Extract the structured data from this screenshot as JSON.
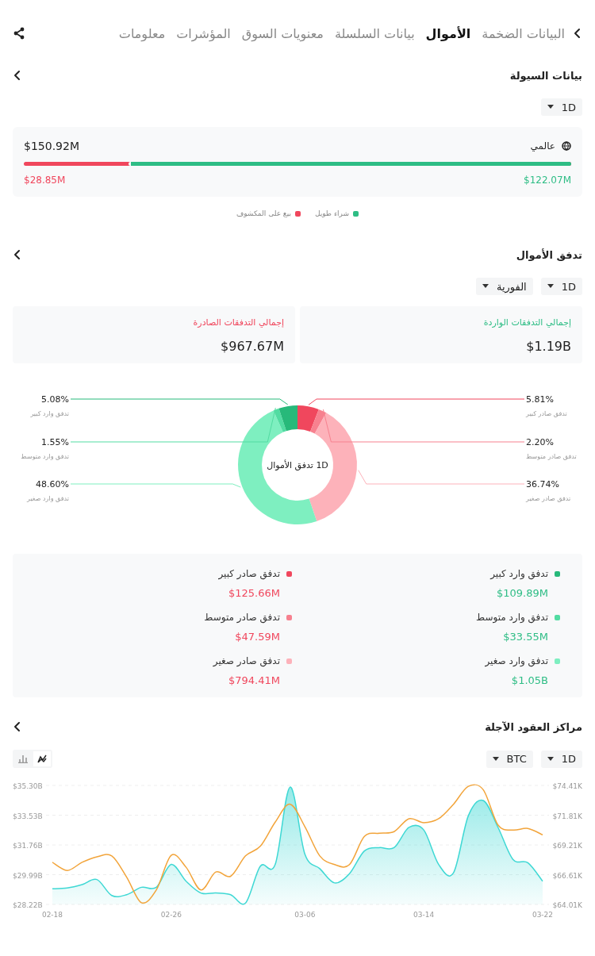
{
  "header": {
    "tabs": [
      {
        "label": "البيانات الضخمة",
        "selected": false
      },
      {
        "label": "الأموال",
        "selected": true
      },
      {
        "label": "بيانات السلسلة",
        "selected": false
      },
      {
        "label": "معنويات السوق",
        "selected": false
      },
      {
        "label": "المؤشرات",
        "selected": false
      },
      {
        "label": "معلومات",
        "selected": false
      }
    ]
  },
  "liquidity": {
    "title": "بيانات السيولة",
    "filters": [
      "1D"
    ],
    "scope": "عالمي",
    "total": "$150.92M",
    "bar": {
      "level": 0.809
    },
    "long_amount": "$122.07M",
    "short_amount": "$28.85M",
    "legend": [
      {
        "label": "شراء طويل",
        "color": "#2ebd85"
      },
      {
        "label": "بيع على المكشوف",
        "color": "#f0475d"
      }
    ]
  },
  "fund_flow": {
    "title": "تدفق الأموال",
    "filters": [
      "1D",
      "الفورية"
    ],
    "totals": [
      {
        "kind": "inflow",
        "label": "إجمالي التدفقات الواردة",
        "amount": "$1.19B"
      },
      {
        "kind": "outflow",
        "label": "إجمالي التدفقات الصادرة",
        "amount": "$967.67M"
      }
    ],
    "chart_data": {
      "type": "donut",
      "title": "1D تدفق الأموال",
      "categories": [
        "تدفق صادر كبير",
        "تدفق صادر متوسط",
        "تدفق صادر صغير",
        "تدفق وارد صغير",
        "تدفق وارد متوسط",
        "تدفق وارد كبير"
      ],
      "values": [
        5.81,
        2.2,
        36.74,
        48.6,
        1.55,
        5.08
      ],
      "colors": [
        "#f0475d",
        "#f7818f",
        "#fdb2ba",
        "#7eefc0",
        "#52dca2",
        "#27b97a"
      ],
      "value_labels": [
        "5.81%",
        "2.20%",
        "36.74%",
        "48.60%",
        "1.55%",
        "5.08%"
      ]
    },
    "breakdown": [
      {
        "kind": "inflow",
        "name": "تدفق وارد كبير",
        "amount": "$109.89M",
        "color": "#27b97a"
      },
      {
        "kind": "outflow",
        "name": "تدفق صادر كبير",
        "amount": "$125.66M",
        "color": "#f0475d"
      },
      {
        "kind": "inflow",
        "name": "تدفق وارد متوسط",
        "amount": "$33.55M",
        "color": "#52dca2"
      },
      {
        "kind": "outflow",
        "name": "تدفق صادر متوسط",
        "amount": "$47.59M",
        "color": "#f7818f"
      },
      {
        "kind": "inflow",
        "name": "تدفق وارد صغير",
        "amount": "$1.05B",
        "color": "#7eefc0"
      },
      {
        "kind": "outflow",
        "name": "تدفق صادر صغير",
        "amount": "$794.41M",
        "color": "#fdb2ba"
      }
    ]
  },
  "futures": {
    "title": "مراكز العقود الآجلة",
    "filters": [
      "1D",
      "BTC"
    ],
    "view_toggle": [
      {
        "kind": "bar",
        "selected": false
      },
      {
        "kind": "line",
        "selected": true
      }
    ],
    "chart_data": {
      "type": "area",
      "grid": true,
      "categories": [
        "02-18",
        null,
        null,
        null,
        null,
        null,
        null,
        null,
        "02-26",
        null,
        null,
        null,
        null,
        null,
        null,
        null,
        null,
        "03-06",
        null,
        null,
        null,
        null,
        null,
        null,
        null,
        "03-14",
        null,
        null,
        null,
        null,
        null,
        null,
        null,
        "03-22"
      ],
      "ylim": [
        28.22,
        35.3
      ],
      "yticks": [
        {
          "value": 28.22,
          "label": "$28.22B"
        },
        {
          "value": 29.99,
          "label": "$29.99B"
        },
        {
          "value": 31.76,
          "label": "$31.76B"
        },
        {
          "value": 33.53,
          "label": "$33.53B"
        },
        {
          "value": 35.3,
          "label": "$35.30B"
        }
      ],
      "y2lim": [
        64.01,
        74.41
      ],
      "y2ticks": [
        {
          "value": 64.01,
          "label": "$64.01K"
        },
        {
          "value": 66.61,
          "label": "$66.61K"
        },
        {
          "value": 69.21,
          "label": "$69.21K"
        },
        {
          "value": 71.81,
          "label": "$71.81K"
        },
        {
          "value": 74.41,
          "label": "$74.41K"
        }
      ],
      "series": [
        {
          "color": "#3ed8d4",
          "values": [
            29.15,
            29.2,
            29.4,
            29.7,
            28.75,
            28.8,
            29.24,
            29.24,
            30.6,
            29.6,
            28.9,
            28.9,
            28.8,
            28.3,
            30.5,
            30.6,
            35.2,
            31.2,
            30.35,
            29.5,
            30.05,
            31.4,
            31.6,
            31.6,
            32.8,
            32.65,
            30.6,
            30.1,
            33.5,
            34.4,
            32.8,
            30.9,
            30.7,
            29.6
          ]
        },
        {
          "axis": "y2",
          "type": "line",
          "color": "#f2a43a",
          "values": [
            67.69,
            66.98,
            67.69,
            68.17,
            68.25,
            66.4,
            64.16,
            65.28,
            68.3,
            67.26,
            65.28,
            66.84,
            66.47,
            68.25,
            69.1,
            71.2,
            72.77,
            70.8,
            68.25,
            67.49,
            67.49,
            69.95,
            70.23,
            70.37,
            71.5,
            71.16,
            71.5,
            72.77,
            74.33,
            74.04,
            70.94,
            70.51,
            70.65,
            70.09
          ]
        }
      ]
    }
  }
}
